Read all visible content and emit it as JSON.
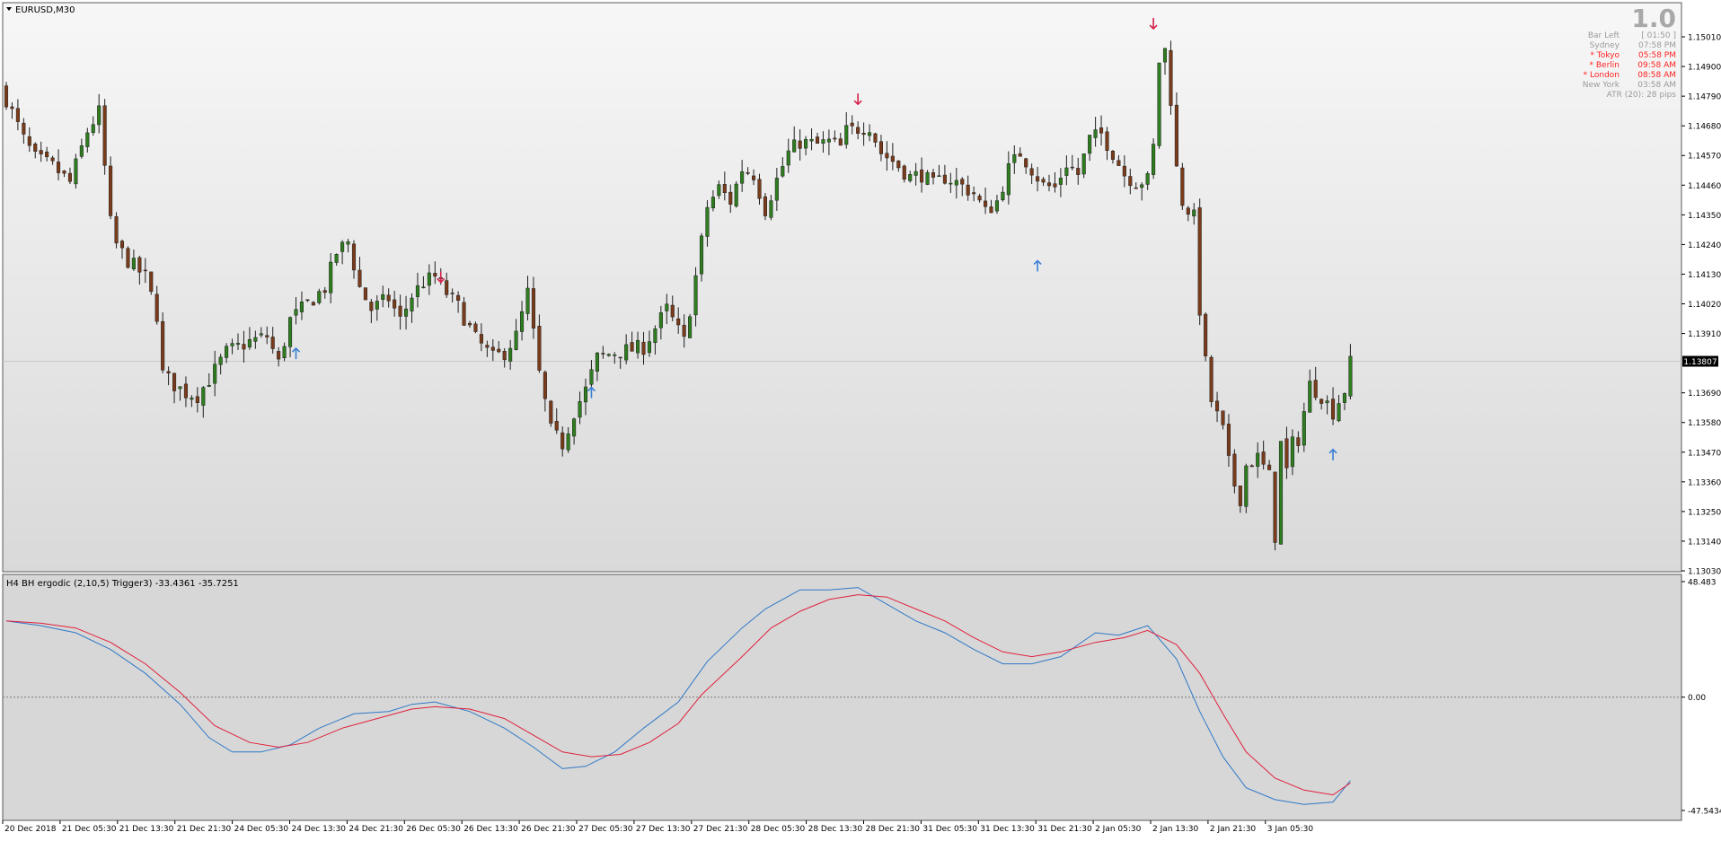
{
  "window": {
    "symbol_label": "EURUSD,M30",
    "indicator_label": "H4 BH ergodic (2,10,5) Trigger3) -33.4361 -35.7251"
  },
  "info_panel": {
    "big_value": "1.0",
    "rows": [
      {
        "label": "Bar Left",
        "value": "[ 01:50 ]",
        "color": "#9a9a9a"
      },
      {
        "label": "Sydney",
        "value": "07:58 PM",
        "color": "#9a9a9a"
      },
      {
        "label": "* Tokyo",
        "value": "05:58 PM",
        "color": "#ff2222"
      },
      {
        "label": "* Berlin",
        "value": "09:58 AM",
        "color": "#ff2222"
      },
      {
        "label": "* London",
        "value": "08:58 AM",
        "color": "#ff2222"
      },
      {
        "label": "New York",
        "value": "03:58 AM",
        "color": "#9a9a9a"
      }
    ],
    "atr_text": "ATR (20): 28 pips"
  },
  "colors": {
    "bull_candle": "#2e7d1f",
    "bear_candle": "#7a3b1a",
    "up_arrow": "#3a7fd5",
    "down_arrow": "#d6204a",
    "ergodic_line": "#2f78c8",
    "trigger_line": "#e0203c"
  },
  "chart_data": [
    {
      "type": "candlestick",
      "symbol": "EURUSD",
      "timeframe": "M30",
      "ylim": [
        1.1303,
        1.1508
      ],
      "y_tick_labels": [
        "1.15010",
        "1.14900",
        "1.14790",
        "1.14680",
        "1.14570",
        "1.14460",
        "1.14350",
        "1.14240",
        "1.14130",
        "1.14020",
        "1.13910",
        "1.13690",
        "1.13580",
        "1.13470",
        "1.13360",
        "1.13250",
        "1.13140",
        "1.13030"
      ],
      "current_price": "1.13807",
      "x_tick_labels": [
        "20 Dec 2018",
        "21 Dec 05:30",
        "21 Dec 13:30",
        "21 Dec 21:30",
        "24 Dec 05:30",
        "24 Dec 13:30",
        "24 Dec 21:30",
        "26 Dec 05:30",
        "26 Dec 13:30",
        "26 Dec 21:30",
        "27 Dec 05:30",
        "27 Dec 13:30",
        "27 Dec 21:30",
        "28 Dec 05:30",
        "28 Dec 13:30",
        "28 Dec 21:30",
        "31 Dec 05:30",
        "31 Dec 13:30",
        "31 Dec 21:30",
        "2 Jan 05:30",
        "2 Jan 13:30",
        "2 Jan 21:30",
        "3 Jan 05:30"
      ],
      "close_path": [
        [
          0,
          1.1478
        ],
        [
          3,
          1.1463
        ],
        [
          5,
          1.1456
        ],
        [
          8,
          1.1453
        ],
        [
          11,
          1.1447
        ],
        [
          14,
          1.1466
        ],
        [
          16,
          1.1473
        ],
        [
          18,
          1.1432
        ],
        [
          19,
          1.1424
        ],
        [
          21,
          1.1418
        ],
        [
          24,
          1.1412
        ],
        [
          26,
          1.1398
        ],
        [
          27,
          1.1376
        ],
        [
          29,
          1.1372
        ],
        [
          31,
          1.1369
        ],
        [
          33,
          1.1368
        ],
        [
          35,
          1.1374
        ],
        [
          38,
          1.1384
        ],
        [
          42,
          1.1388
        ],
        [
          45,
          1.139
        ],
        [
          47,
          1.138
        ],
        [
          49,
          1.1396
        ],
        [
          52,
          1.1402
        ],
        [
          55,
          1.1408
        ],
        [
          57,
          1.1421
        ],
        [
          59,
          1.1425
        ],
        [
          61,
          1.1408
        ],
        [
          63,
          1.14
        ],
        [
          66,
          1.1404
        ],
        [
          68,
          1.1396
        ],
        [
          70,
          1.1405
        ],
        [
          72,
          1.141
        ],
        [
          74,
          1.1412
        ],
        [
          76,
          1.1406
        ],
        [
          78,
          1.1401
        ],
        [
          81,
          1.1389
        ],
        [
          84,
          1.1382
        ],
        [
          86,
          1.1384
        ],
        [
          88,
          1.139
        ],
        [
          90,
          1.1406
        ],
        [
          92,
          1.1376
        ],
        [
          94,
          1.1355
        ],
        [
          96,
          1.135
        ],
        [
          98,
          1.1362
        ],
        [
          100,
          1.137
        ],
        [
          102,
          1.1382
        ],
        [
          105,
          1.1384
        ],
        [
          108,
          1.1385
        ],
        [
          110,
          1.1386
        ],
        [
          112,
          1.1393
        ],
        [
          114,
          1.14
        ],
        [
          117,
          1.1388
        ],
        [
          119,
          1.1412
        ],
        [
          121,
          1.1438
        ],
        [
          123,
          1.1445
        ],
        [
          125,
          1.144
        ],
        [
          127,
          1.1452
        ],
        [
          129,
          1.145
        ],
        [
          131,
          1.1437
        ],
        [
          133,
          1.1448
        ],
        [
          135,
          1.1458
        ],
        [
          137,
          1.1462
        ],
        [
          140,
          1.1461
        ],
        [
          142,
          1.1462
        ],
        [
          144,
          1.146
        ],
        [
          145,
          1.1466
        ],
        [
          147,
          1.1467
        ],
        [
          149,
          1.1468
        ],
        [
          151,
          1.1458
        ],
        [
          153,
          1.1455
        ],
        [
          156,
          1.1449
        ],
        [
          158,
          1.145
        ],
        [
          160,
          1.1446
        ],
        [
          162,
          1.1449
        ],
        [
          164,
          1.1447
        ],
        [
          167,
          1.1443
        ],
        [
          169,
          1.1436
        ],
        [
          171,
          1.144
        ],
        [
          173,
          1.1452
        ],
        [
          175,
          1.1458
        ],
        [
          177,
          1.1452
        ],
        [
          179,
          1.1446
        ],
        [
          181,
          1.1445
        ],
        [
          183,
          1.1454
        ],
        [
          185,
          1.145
        ],
        [
          187,
          1.1463
        ],
        [
          189,
          1.1465
        ],
        [
          191,
          1.1458
        ],
        [
          193,
          1.145
        ],
        [
          195,
          1.1447
        ],
        [
          197,
          1.1448
        ],
        [
          198,
          1.146
        ],
        [
          199,
          1.1492
        ],
        [
          200,
          1.1496
        ],
        [
          201,
          1.1478
        ],
        [
          202,
          1.1452
        ],
        [
          203,
          1.144
        ],
        [
          205,
          1.1434
        ],
        [
          206,
          1.14
        ],
        [
          207,
          1.138
        ],
        [
          208,
          1.1366
        ],
        [
          210,
          1.1355
        ],
        [
          211,
          1.1343
        ],
        [
          212,
          1.1335
        ],
        [
          213,
          1.133
        ],
        [
          214,
          1.1342
        ],
        [
          216,
          1.1345
        ],
        [
          218,
          1.1338
        ],
        [
          219,
          1.1316
        ],
        [
          220,
          1.135
        ],
        [
          221,
          1.134
        ],
        [
          222,
          1.135
        ],
        [
          223,
          1.1352
        ],
        [
          224,
          1.1362
        ],
        [
          225,
          1.1372
        ],
        [
          227,
          1.1368
        ],
        [
          229,
          1.1362
        ],
        [
          231,
          1.137
        ],
        [
          232,
          1.138
        ]
      ],
      "candles_total": 233,
      "signal_arrows": [
        {
          "bar": 50,
          "dir": "up",
          "price": 1.13835
        },
        {
          "bar": 75,
          "dir": "down",
          "price": 1.1412
        },
        {
          "bar": 101,
          "dir": "up",
          "price": 1.1369
        },
        {
          "bar": 147,
          "dir": "down",
          "price": 1.1478
        },
        {
          "bar": 178,
          "dir": "up",
          "price": 1.1416
        },
        {
          "bar": 198,
          "dir": "down",
          "price": 1.1506
        },
        {
          "bar": 229,
          "dir": "up",
          "price": 1.1346
        }
      ]
    },
    {
      "type": "line",
      "title": "H4 BH ergodic (2,10,5) Trigger3)",
      "ylim": [
        -47.5434,
        48.483
      ],
      "y_tick_labels": [
        "48.483",
        "0.00",
        "-47.5434"
      ],
      "zero_line": true,
      "series": [
        {
          "name": "ergodic",
          "color": "#2f78c8",
          "points": [
            [
              0,
              32
            ],
            [
              6,
              30
            ],
            [
              12,
              27
            ],
            [
              18,
              20
            ],
            [
              24,
              10
            ],
            [
              30,
              -3
            ],
            [
              35,
              -17
            ],
            [
              39,
              -23
            ],
            [
              44,
              -23
            ],
            [
              49,
              -20
            ],
            [
              54,
              -13
            ],
            [
              60,
              -7
            ],
            [
              66,
              -6
            ],
            [
              70,
              -3
            ],
            [
              74,
              -2
            ],
            [
              80,
              -6
            ],
            [
              86,
              -13
            ],
            [
              91,
              -21
            ],
            [
              96,
              -30
            ],
            [
              100,
              -29
            ],
            [
              105,
              -23
            ],
            [
              110,
              -13
            ],
            [
              116,
              -2
            ],
            [
              121,
              15
            ],
            [
              127,
              29
            ],
            [
              131,
              37
            ],
            [
              137,
              45
            ],
            [
              142,
              45
            ],
            [
              147,
              46
            ],
            [
              152,
              39
            ],
            [
              157,
              32
            ],
            [
              162,
              27
            ],
            [
              167,
              20
            ],
            [
              172,
              14
            ],
            [
              177,
              14
            ],
            [
              182,
              17
            ],
            [
              188,
              27
            ],
            [
              192,
              26
            ],
            [
              197,
              30
            ],
            [
              202,
              16
            ],
            [
              206,
              -6
            ],
            [
              210,
              -25
            ],
            [
              214,
              -38
            ],
            [
              219,
              -43
            ],
            [
              224,
              -45
            ],
            [
              229,
              -44
            ],
            [
              232,
              -35
            ]
          ]
        },
        {
          "name": "trigger",
          "color": "#e0203c",
          "points": [
            [
              0,
              32
            ],
            [
              6,
              31
            ],
            [
              12,
              29
            ],
            [
              18,
              23
            ],
            [
              24,
              14
            ],
            [
              30,
              2
            ],
            [
              36,
              -12
            ],
            [
              42,
              -19
            ],
            [
              47,
              -21
            ],
            [
              52,
              -19
            ],
            [
              58,
              -13
            ],
            [
              64,
              -9
            ],
            [
              70,
              -5
            ],
            [
              74,
              -4
            ],
            [
              80,
              -5
            ],
            [
              86,
              -9
            ],
            [
              91,
              -16
            ],
            [
              96,
              -23
            ],
            [
              101,
              -25
            ],
            [
              106,
              -24
            ],
            [
              111,
              -19
            ],
            [
              116,
              -11
            ],
            [
              120,
              1
            ],
            [
              127,
              17
            ],
            [
              132,
              29
            ],
            [
              137,
              36
            ],
            [
              142,
              41
            ],
            [
              147,
              43
            ],
            [
              152,
              42
            ],
            [
              157,
              37
            ],
            [
              162,
              32
            ],
            [
              167,
              25
            ],
            [
              172,
              19
            ],
            [
              177,
              17
            ],
            [
              182,
              19
            ],
            [
              188,
              23
            ],
            [
              193,
              25
            ],
            [
              197,
              28
            ],
            [
              202,
              22
            ],
            [
              206,
              10
            ],
            [
              210,
              -7
            ],
            [
              214,
              -23
            ],
            [
              219,
              -34
            ],
            [
              224,
              -39
            ],
            [
              229,
              -41
            ],
            [
              232,
              -36
            ]
          ]
        }
      ]
    }
  ]
}
